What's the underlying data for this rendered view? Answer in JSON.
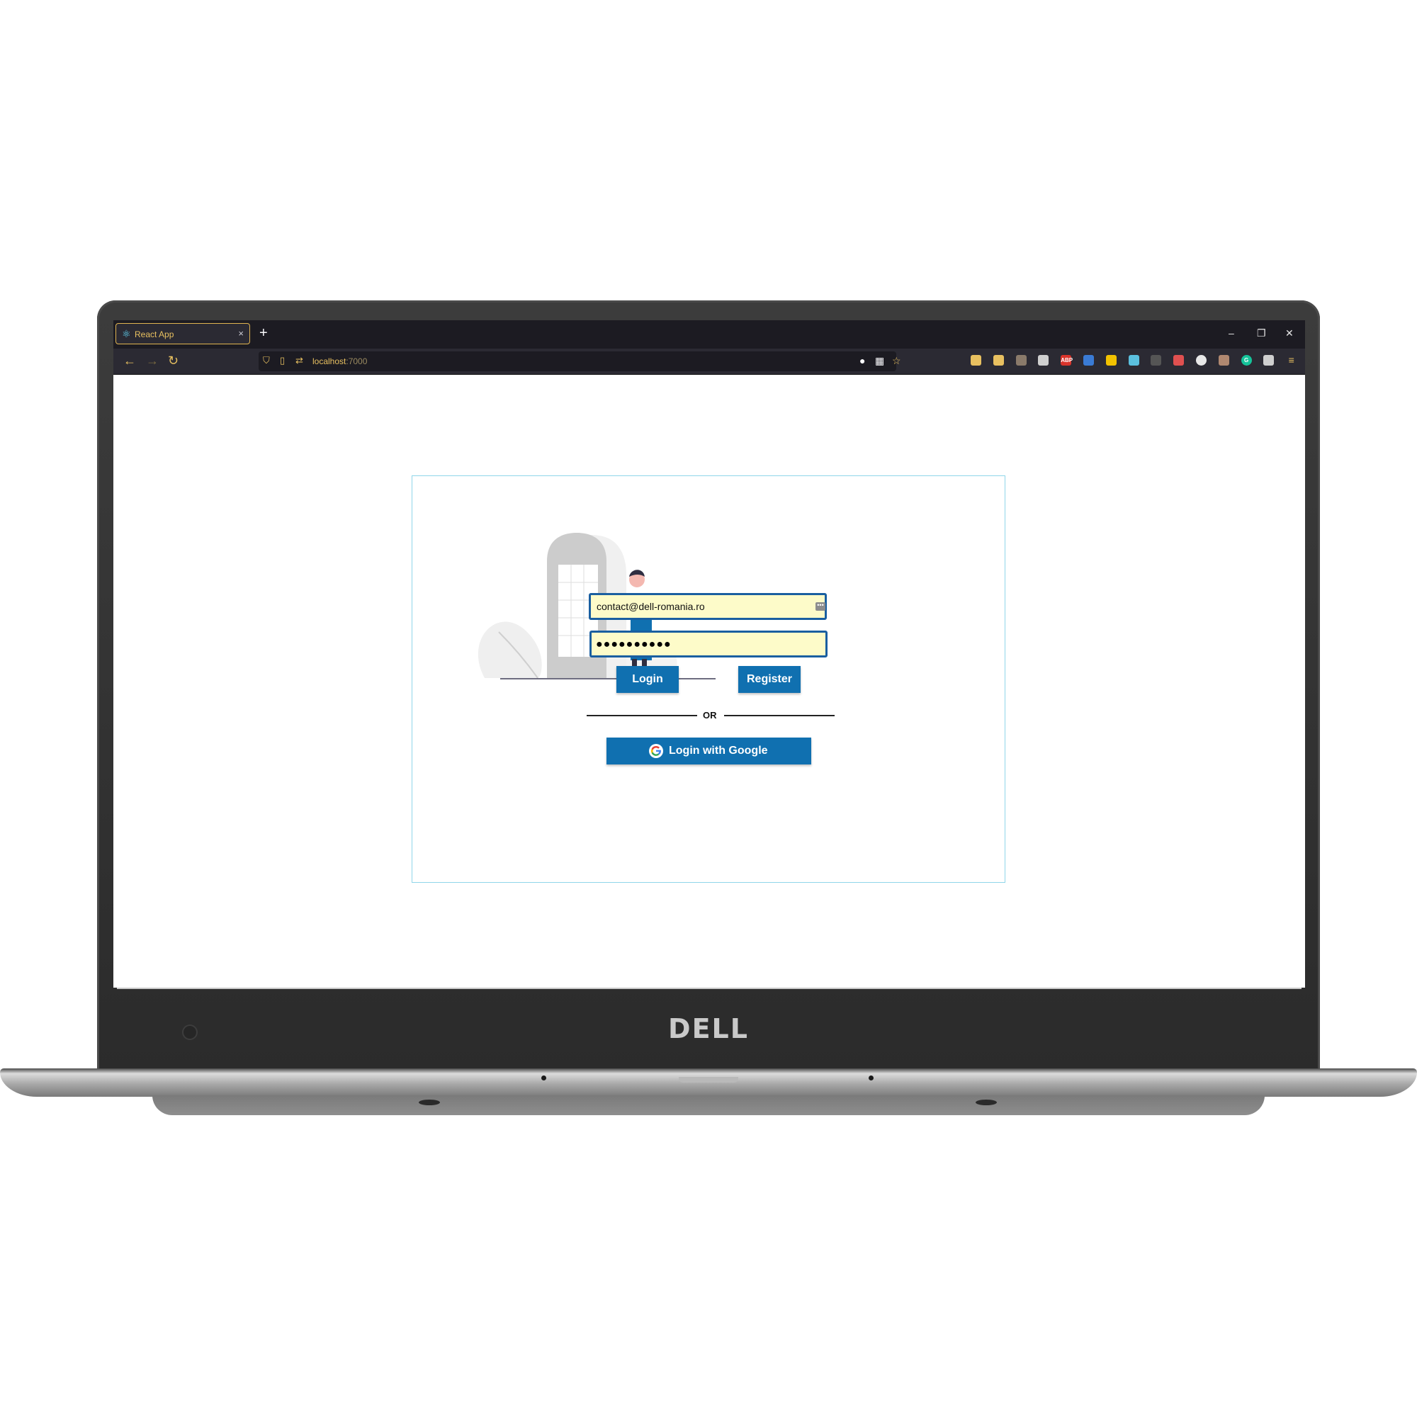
{
  "browser": {
    "tab_title": "React App",
    "tab_close": "×",
    "new_tab": "+",
    "window_controls": {
      "minimize": "–",
      "restore": "❐",
      "close": "✕"
    },
    "nav": {
      "back": "←",
      "forward": "→",
      "reload": "↻"
    },
    "url_host": "localhost",
    "url_port": ":7000",
    "accent_color": "#e8c060",
    "extensions": [
      {
        "name": "pocket-icon",
        "color": "#e8c060",
        "label": ""
      },
      {
        "name": "download-icon",
        "color": "#e8c060",
        "label": ""
      },
      {
        "name": "avatar-extension-icon",
        "color": "#8a7a6a",
        "label": ""
      },
      {
        "name": "cookie-icon",
        "color": "#cfcfcf",
        "label": ""
      },
      {
        "name": "adblock-icon",
        "color": "#d9342b",
        "label": "ABP"
      },
      {
        "name": "library-icon",
        "color": "#3a7bd5",
        "label": ""
      },
      {
        "name": "notes-icon",
        "color": "#f2c200",
        "label": ""
      },
      {
        "name": "save-icon",
        "color": "#5bc0de",
        "label": ""
      },
      {
        "name": "terminal-icon",
        "color": "#555555",
        "label": ""
      },
      {
        "name": "shield-extension-icon",
        "color": "#e05050",
        "label": ""
      },
      {
        "name": "circle-extension-icon",
        "color": "#e8e8e8",
        "label": ""
      },
      {
        "name": "face-extension-icon",
        "color": "#b08870",
        "label": ""
      },
      {
        "name": "grammarly-icon",
        "color": "#15c39a",
        "label": "G"
      },
      {
        "name": "extensions-puzzle-icon",
        "color": "#cfcfcf",
        "label": ""
      },
      {
        "name": "menu-icon",
        "color": "#e8c060",
        "label": ""
      }
    ]
  },
  "login": {
    "email_value": "contact@dell-romania.ro",
    "password_dots": "●●●●●●●●●●",
    "login_label": "Login",
    "register_label": "Register",
    "or_label": "OR",
    "google_label": "Login with Google",
    "button_color": "#1070b0",
    "field_bg": "#fdfbc9"
  },
  "device": {
    "brand": "DELL"
  }
}
